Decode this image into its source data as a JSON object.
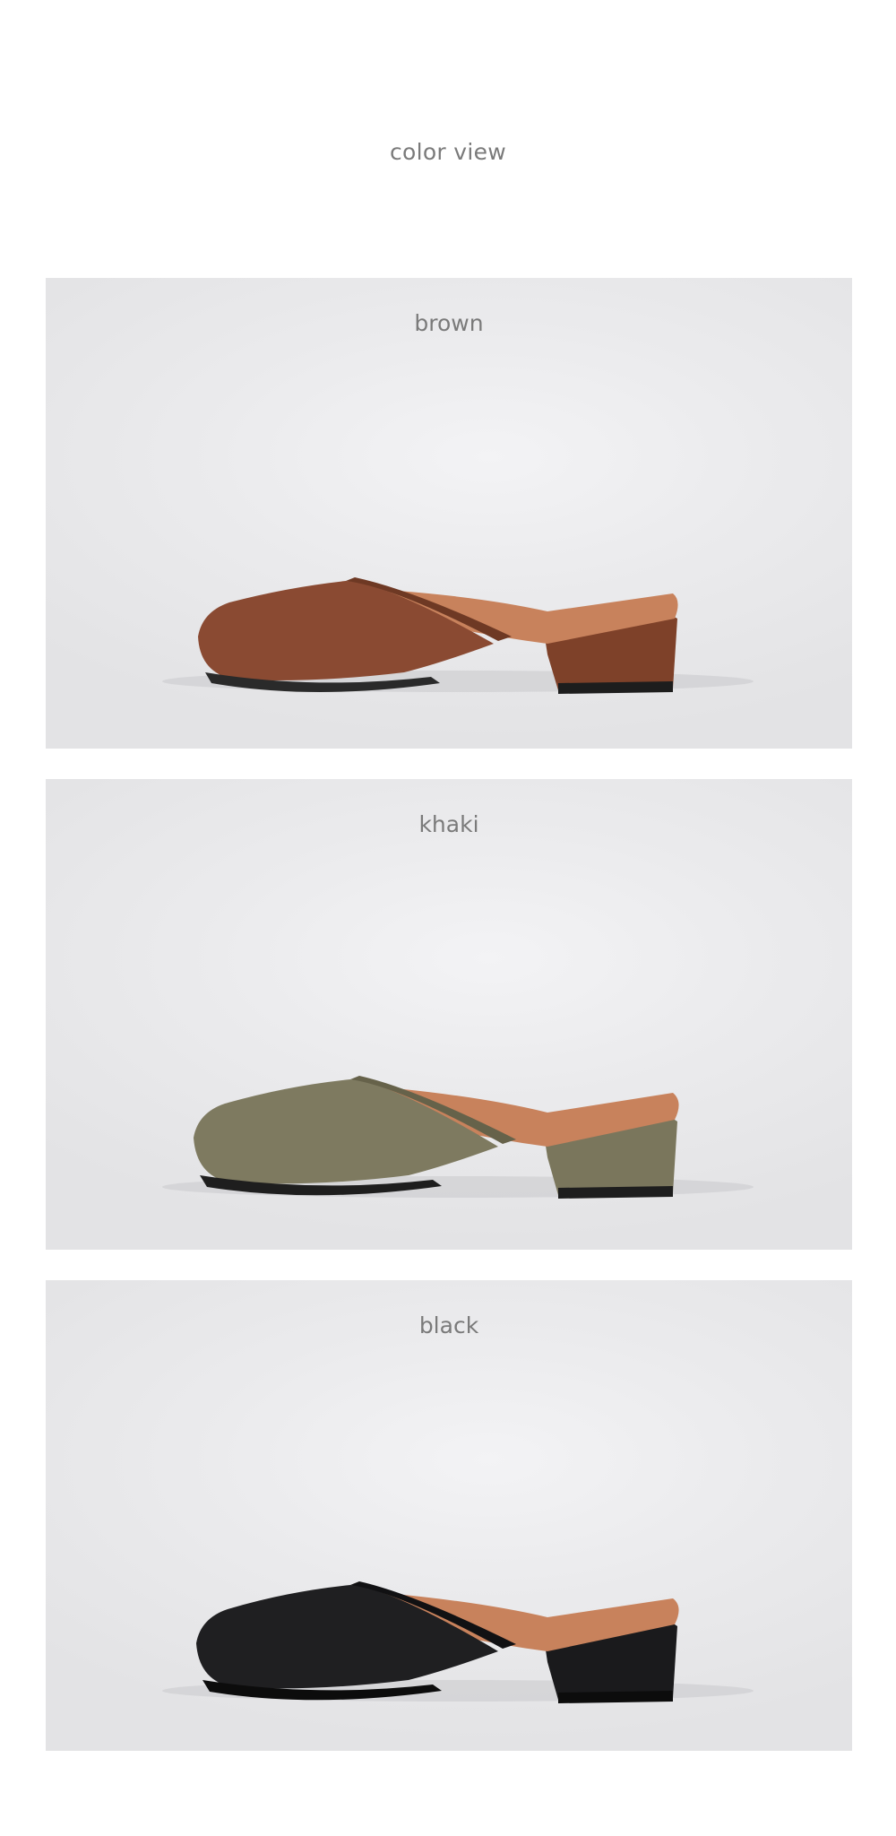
{
  "header": {
    "title": "color view"
  },
  "colors": [
    {
      "label": "brown",
      "shoe_name": "brown",
      "upper": "#8a4a32",
      "upper_shade": "#6e3924",
      "heel": "#7e4129",
      "sole": "#2a2a2a"
    },
    {
      "label": "khaki",
      "shoe_name": "khaki",
      "upper": "#7e7a60",
      "upper_shade": "#66624a",
      "heel": "#7a765c",
      "sole": "#1e1e1e"
    },
    {
      "label": "black",
      "shoe_name": "black",
      "upper": "#1f1f21",
      "upper_shade": "#111113",
      "heel": "#1a1a1c",
      "sole": "#0c0c0c"
    }
  ],
  "theme": {
    "lining": "#c8825c",
    "lining_light": "#d99a72",
    "label_color": "#7a7a7a"
  }
}
